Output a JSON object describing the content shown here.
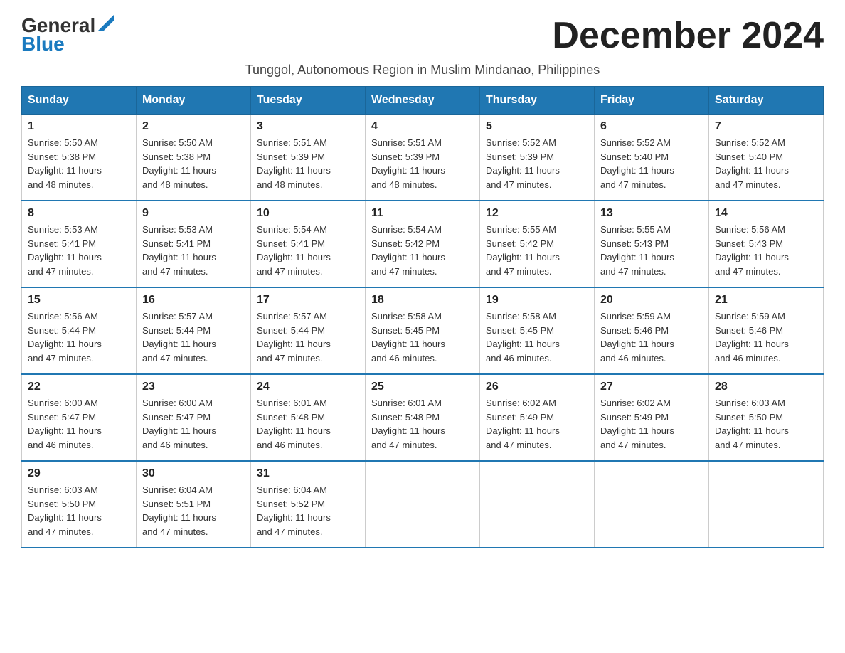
{
  "header": {
    "title": "December 2024",
    "subtitle": "Tunggol, Autonomous Region in Muslim Mindanao, Philippines"
  },
  "logo": {
    "general": "General",
    "blue": "Blue"
  },
  "days_of_week": [
    "Sunday",
    "Monday",
    "Tuesday",
    "Wednesday",
    "Thursday",
    "Friday",
    "Saturday"
  ],
  "weeks": [
    [
      {
        "day": "1",
        "sunrise": "5:50 AM",
        "sunset": "5:38 PM",
        "daylight": "11 hours and 48 minutes."
      },
      {
        "day": "2",
        "sunrise": "5:50 AM",
        "sunset": "5:38 PM",
        "daylight": "11 hours and 48 minutes."
      },
      {
        "day": "3",
        "sunrise": "5:51 AM",
        "sunset": "5:39 PM",
        "daylight": "11 hours and 48 minutes."
      },
      {
        "day": "4",
        "sunrise": "5:51 AM",
        "sunset": "5:39 PM",
        "daylight": "11 hours and 48 minutes."
      },
      {
        "day": "5",
        "sunrise": "5:52 AM",
        "sunset": "5:39 PM",
        "daylight": "11 hours and 47 minutes."
      },
      {
        "day": "6",
        "sunrise": "5:52 AM",
        "sunset": "5:40 PM",
        "daylight": "11 hours and 47 minutes."
      },
      {
        "day": "7",
        "sunrise": "5:52 AM",
        "sunset": "5:40 PM",
        "daylight": "11 hours and 47 minutes."
      }
    ],
    [
      {
        "day": "8",
        "sunrise": "5:53 AM",
        "sunset": "5:41 PM",
        "daylight": "11 hours and 47 minutes."
      },
      {
        "day": "9",
        "sunrise": "5:53 AM",
        "sunset": "5:41 PM",
        "daylight": "11 hours and 47 minutes."
      },
      {
        "day": "10",
        "sunrise": "5:54 AM",
        "sunset": "5:41 PM",
        "daylight": "11 hours and 47 minutes."
      },
      {
        "day": "11",
        "sunrise": "5:54 AM",
        "sunset": "5:42 PM",
        "daylight": "11 hours and 47 minutes."
      },
      {
        "day": "12",
        "sunrise": "5:55 AM",
        "sunset": "5:42 PM",
        "daylight": "11 hours and 47 minutes."
      },
      {
        "day": "13",
        "sunrise": "5:55 AM",
        "sunset": "5:43 PM",
        "daylight": "11 hours and 47 minutes."
      },
      {
        "day": "14",
        "sunrise": "5:56 AM",
        "sunset": "5:43 PM",
        "daylight": "11 hours and 47 minutes."
      }
    ],
    [
      {
        "day": "15",
        "sunrise": "5:56 AM",
        "sunset": "5:44 PM",
        "daylight": "11 hours and 47 minutes."
      },
      {
        "day": "16",
        "sunrise": "5:57 AM",
        "sunset": "5:44 PM",
        "daylight": "11 hours and 47 minutes."
      },
      {
        "day": "17",
        "sunrise": "5:57 AM",
        "sunset": "5:44 PM",
        "daylight": "11 hours and 47 minutes."
      },
      {
        "day": "18",
        "sunrise": "5:58 AM",
        "sunset": "5:45 PM",
        "daylight": "11 hours and 46 minutes."
      },
      {
        "day": "19",
        "sunrise": "5:58 AM",
        "sunset": "5:45 PM",
        "daylight": "11 hours and 46 minutes."
      },
      {
        "day": "20",
        "sunrise": "5:59 AM",
        "sunset": "5:46 PM",
        "daylight": "11 hours and 46 minutes."
      },
      {
        "day": "21",
        "sunrise": "5:59 AM",
        "sunset": "5:46 PM",
        "daylight": "11 hours and 46 minutes."
      }
    ],
    [
      {
        "day": "22",
        "sunrise": "6:00 AM",
        "sunset": "5:47 PM",
        "daylight": "11 hours and 46 minutes."
      },
      {
        "day": "23",
        "sunrise": "6:00 AM",
        "sunset": "5:47 PM",
        "daylight": "11 hours and 46 minutes."
      },
      {
        "day": "24",
        "sunrise": "6:01 AM",
        "sunset": "5:48 PM",
        "daylight": "11 hours and 46 minutes."
      },
      {
        "day": "25",
        "sunrise": "6:01 AM",
        "sunset": "5:48 PM",
        "daylight": "11 hours and 47 minutes."
      },
      {
        "day": "26",
        "sunrise": "6:02 AM",
        "sunset": "5:49 PM",
        "daylight": "11 hours and 47 minutes."
      },
      {
        "day": "27",
        "sunrise": "6:02 AM",
        "sunset": "5:49 PM",
        "daylight": "11 hours and 47 minutes."
      },
      {
        "day": "28",
        "sunrise": "6:03 AM",
        "sunset": "5:50 PM",
        "daylight": "11 hours and 47 minutes."
      }
    ],
    [
      {
        "day": "29",
        "sunrise": "6:03 AM",
        "sunset": "5:50 PM",
        "daylight": "11 hours and 47 minutes."
      },
      {
        "day": "30",
        "sunrise": "6:04 AM",
        "sunset": "5:51 PM",
        "daylight": "11 hours and 47 minutes."
      },
      {
        "day": "31",
        "sunrise": "6:04 AM",
        "sunset": "5:52 PM",
        "daylight": "11 hours and 47 minutes."
      },
      null,
      null,
      null,
      null
    ]
  ],
  "labels": {
    "sunrise": "Sunrise:",
    "sunset": "Sunset:",
    "daylight": "Daylight:"
  }
}
